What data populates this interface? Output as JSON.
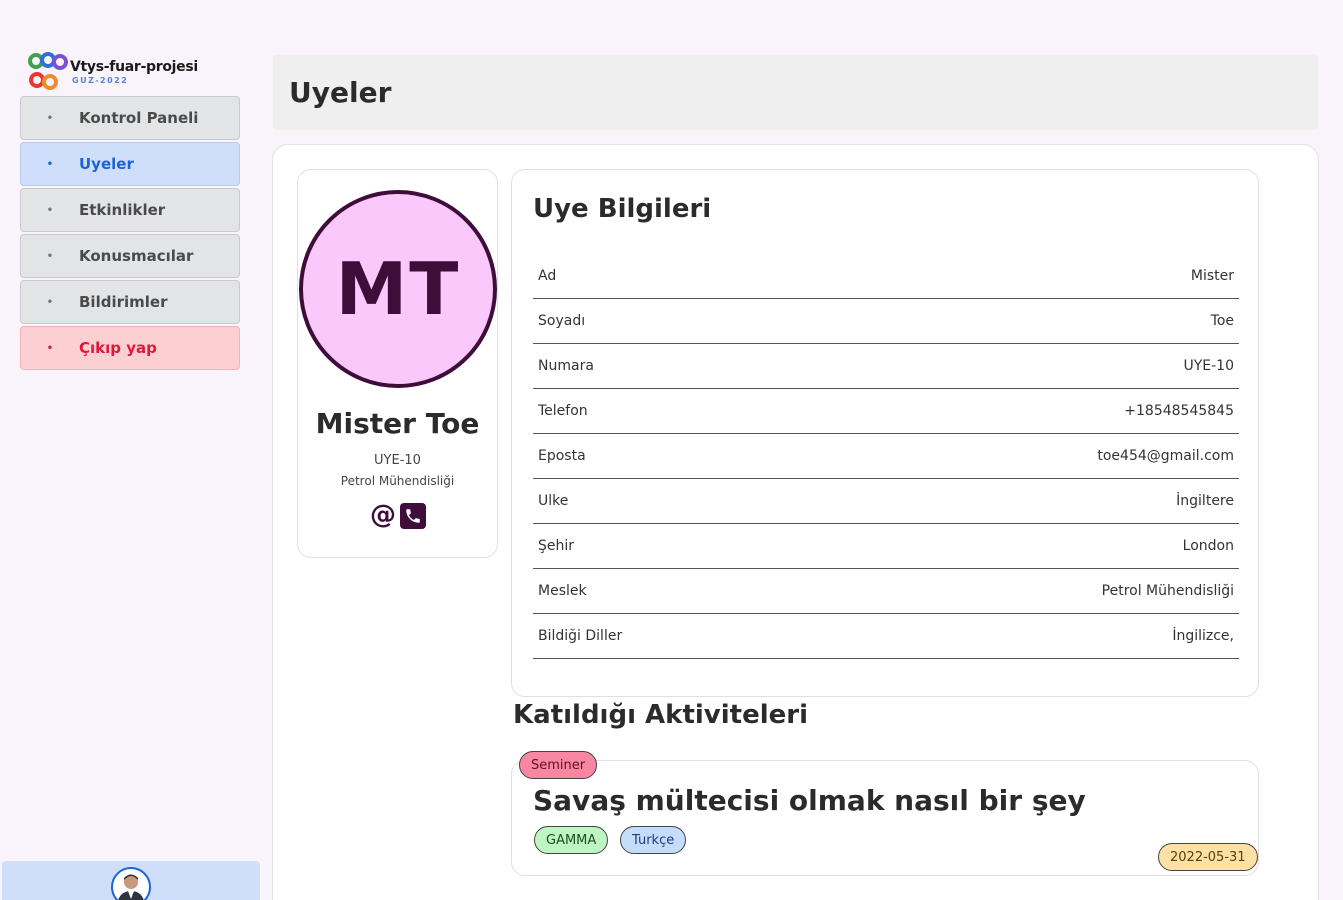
{
  "app": {
    "logo_title": "Vtys-fuar-projesi",
    "logo_subtitle": "GUZ-2022"
  },
  "sidebar": {
    "items": [
      {
        "label": "Kontrol Paneli",
        "state": "default"
      },
      {
        "label": "Uyeler",
        "state": "active"
      },
      {
        "label": "Etkinlikler",
        "state": "default"
      },
      {
        "label": "Konusmacılar",
        "state": "default"
      },
      {
        "label": "Bildirimler",
        "state": "default"
      },
      {
        "label": "Çıkıp yap",
        "state": "danger"
      }
    ]
  },
  "header": {
    "title": "Uyeler"
  },
  "profile": {
    "initials": "MT",
    "name": "Mister Toe",
    "number": "UYE-10",
    "job": "Petrol Mühendisliği",
    "icons": [
      "at-icon",
      "phone-icon"
    ]
  },
  "info": {
    "title": "Uye Bilgileri",
    "rows": [
      {
        "label": "Ad",
        "value": "Mister"
      },
      {
        "label": "Soyadı",
        "value": "Toe"
      },
      {
        "label": "Numara",
        "value": "UYE-10"
      },
      {
        "label": "Telefon",
        "value": "+18548545845"
      },
      {
        "label": "Eposta",
        "value": "toe454@gmail.com"
      },
      {
        "label": "Ulke",
        "value": "İngiltere"
      },
      {
        "label": "Şehir",
        "value": "London"
      },
      {
        "label": "Meslek",
        "value": "Petrol Mühendisliği"
      },
      {
        "label": "Bildiği Diller",
        "value": "İngilizce,"
      }
    ]
  },
  "activities": {
    "title": "Katıldığı Aktiviteleri",
    "items": [
      {
        "type": "Seminer",
        "title": "Savaş mültecisi olmak nasıl bir şey",
        "hall": "GAMMA",
        "language": "Turkçe",
        "date": "2022-05-31"
      }
    ]
  },
  "colors": {
    "accent": "#1a63d8",
    "danger": "#e0183a",
    "avatar_bg": "#fac8fb",
    "avatar_fg": "#3e0d3a"
  }
}
